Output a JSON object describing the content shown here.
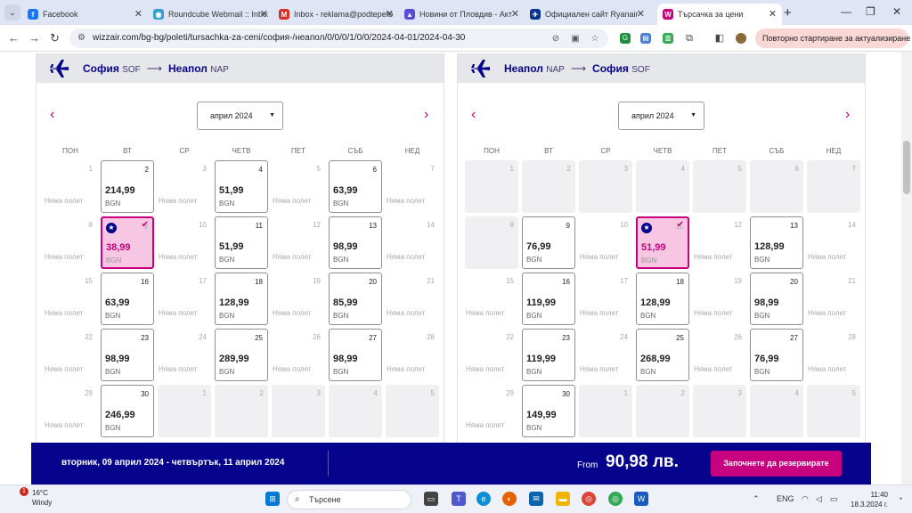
{
  "browser": {
    "tabs": [
      {
        "title": "Facebook",
        "icon": "facebook-icon",
        "color": "#1877f2",
        "glyph": "f"
      },
      {
        "title": "Roundcube Webmail :: Inbox",
        "icon": "roundcube-icon",
        "color": "#37a0d0",
        "glyph": "◉"
      },
      {
        "title": "Inbox - reklama@podtepeto",
        "icon": "gmail-icon",
        "color": "#d93025",
        "glyph": "M"
      },
      {
        "title": "Новини от Пловдив - Акт",
        "icon": "news-icon",
        "color": "#5b4bd6",
        "glyph": "▲"
      },
      {
        "title": "Официален сайт Ryanair",
        "icon": "ryanair-icon",
        "color": "#073590",
        "glyph": "✈"
      },
      {
        "title": "Търсачка за цени",
        "icon": "wizzair-icon",
        "color": "#c6007e",
        "glyph": "W"
      }
    ],
    "new_tab": "+",
    "controls": {
      "minimize": "—",
      "maximize": "❐",
      "close": "✕"
    },
    "address": "wizzair.com/bg-bg/poleti/tursachka-za-ceni/софия-/неапол/0/0/0/1/0/0/2024-04-01/2024-04-30",
    "relaunch": "Повторно стартиране за актуализиране"
  },
  "panels": [
    {
      "from_city": "София",
      "from_code": "SOF",
      "to_city": "Неапол",
      "to_code": "NAP",
      "month": "април 2024",
      "rows": [
        [
          {
            "d": "1",
            "s": "nf"
          },
          {
            "d": "2",
            "s": "av",
            "p": "214,99"
          },
          {
            "d": "3",
            "s": "nf"
          },
          {
            "d": "4",
            "s": "av",
            "p": "51,99"
          },
          {
            "d": "5",
            "s": "nf"
          },
          {
            "d": "6",
            "s": "av",
            "p": "63,99"
          },
          {
            "d": "7",
            "s": "nf"
          }
        ],
        [
          {
            "d": "8",
            "s": "nf"
          },
          {
            "d": "9",
            "s": "sel",
            "p": "38,99"
          },
          {
            "d": "10",
            "s": "nf"
          },
          {
            "d": "11",
            "s": "av",
            "p": "51,99"
          },
          {
            "d": "12",
            "s": "nf"
          },
          {
            "d": "13",
            "s": "av",
            "p": "98,99"
          },
          {
            "d": "14",
            "s": "nf"
          }
        ],
        [
          {
            "d": "15",
            "s": "nf"
          },
          {
            "d": "16",
            "s": "av",
            "p": "63,99"
          },
          {
            "d": "17",
            "s": "nf"
          },
          {
            "d": "18",
            "s": "av",
            "p": "128,99"
          },
          {
            "d": "19",
            "s": "nf"
          },
          {
            "d": "20",
            "s": "av",
            "p": "85,99"
          },
          {
            "d": "21",
            "s": "nf"
          }
        ],
        [
          {
            "d": "22",
            "s": "nf"
          },
          {
            "d": "23",
            "s": "av",
            "p": "98,99"
          },
          {
            "d": "24",
            "s": "nf"
          },
          {
            "d": "25",
            "s": "av",
            "p": "289,99"
          },
          {
            "d": "26",
            "s": "nf"
          },
          {
            "d": "27",
            "s": "av",
            "p": "98,99"
          },
          {
            "d": "28",
            "s": "nf"
          }
        ],
        [
          {
            "d": "29",
            "s": "nf"
          },
          {
            "d": "30",
            "s": "av",
            "p": "246,99"
          },
          {
            "d": "1",
            "s": "pa"
          },
          {
            "d": "2",
            "s": "pa"
          },
          {
            "d": "3",
            "s": "pa"
          },
          {
            "d": "4",
            "s": "pa"
          },
          {
            "d": "5",
            "s": "pa"
          }
        ]
      ]
    },
    {
      "from_city": "Неапол",
      "from_code": "NAP",
      "to_city": "София",
      "to_code": "SOF",
      "month": "април 2024",
      "rows": [
        [
          {
            "d": "1",
            "s": "pa"
          },
          {
            "d": "2",
            "s": "pa"
          },
          {
            "d": "3",
            "s": "pa"
          },
          {
            "d": "4",
            "s": "pa"
          },
          {
            "d": "5",
            "s": "pa"
          },
          {
            "d": "6",
            "s": "pa"
          },
          {
            "d": "7",
            "s": "pa"
          }
        ],
        [
          {
            "d": "8",
            "s": "pa"
          },
          {
            "d": "9",
            "s": "av",
            "p": "76,99"
          },
          {
            "d": "10",
            "s": "nf"
          },
          {
            "d": "11",
            "s": "sel",
            "p": "51,99"
          },
          {
            "d": "12",
            "s": "nf"
          },
          {
            "d": "13",
            "s": "av",
            "p": "128,99"
          },
          {
            "d": "14",
            "s": "nf"
          }
        ],
        [
          {
            "d": "15",
            "s": "nf"
          },
          {
            "d": "16",
            "s": "av",
            "p": "119,99"
          },
          {
            "d": "17",
            "s": "nf"
          },
          {
            "d": "18",
            "s": "av",
            "p": "128,99"
          },
          {
            "d": "19",
            "s": "nf"
          },
          {
            "d": "20",
            "s": "av",
            "p": "98,99"
          },
          {
            "d": "21",
            "s": "nf"
          }
        ],
        [
          {
            "d": "22",
            "s": "nf"
          },
          {
            "d": "23",
            "s": "av",
            "p": "119,99"
          },
          {
            "d": "24",
            "s": "nf"
          },
          {
            "d": "25",
            "s": "av",
            "p": "268,99"
          },
          {
            "d": "26",
            "s": "nf"
          },
          {
            "d": "27",
            "s": "av",
            "p": "76,99"
          },
          {
            "d": "28",
            "s": "nf"
          }
        ],
        [
          {
            "d": "29",
            "s": "nf"
          },
          {
            "d": "30",
            "s": "av",
            "p": "149,99"
          },
          {
            "d": "1",
            "s": "pa"
          },
          {
            "d": "2",
            "s": "pa"
          },
          {
            "d": "3",
            "s": "pa"
          },
          {
            "d": "4",
            "s": "pa"
          },
          {
            "d": "5",
            "s": "pa"
          }
        ]
      ]
    }
  ],
  "weekdays": [
    "ПОН",
    "ВТ",
    "СР",
    "ЧЕТВ",
    "ПЕТ",
    "СЪБ",
    "НЕД"
  ],
  "no_flight": "Няма полет",
  "currency": "BGN",
  "footer": {
    "dates": "вторник, 09 април 2024 - четвъртък, 11 април 2024",
    "from_label": "From",
    "price": "90,98 лв.",
    "cta": "Започнете да резервирате"
  },
  "taskbar": {
    "temperature": "16°C",
    "weather": "Windy",
    "notifications": "1",
    "search_placeholder": "Търсене",
    "language": "ENG",
    "time": "11:40",
    "date": "18.3.2024 г."
  },
  "colors": {
    "brand_blue": "#06038d",
    "brand_pink": "#c6007e",
    "selected_bg": "#f6c6e2"
  }
}
